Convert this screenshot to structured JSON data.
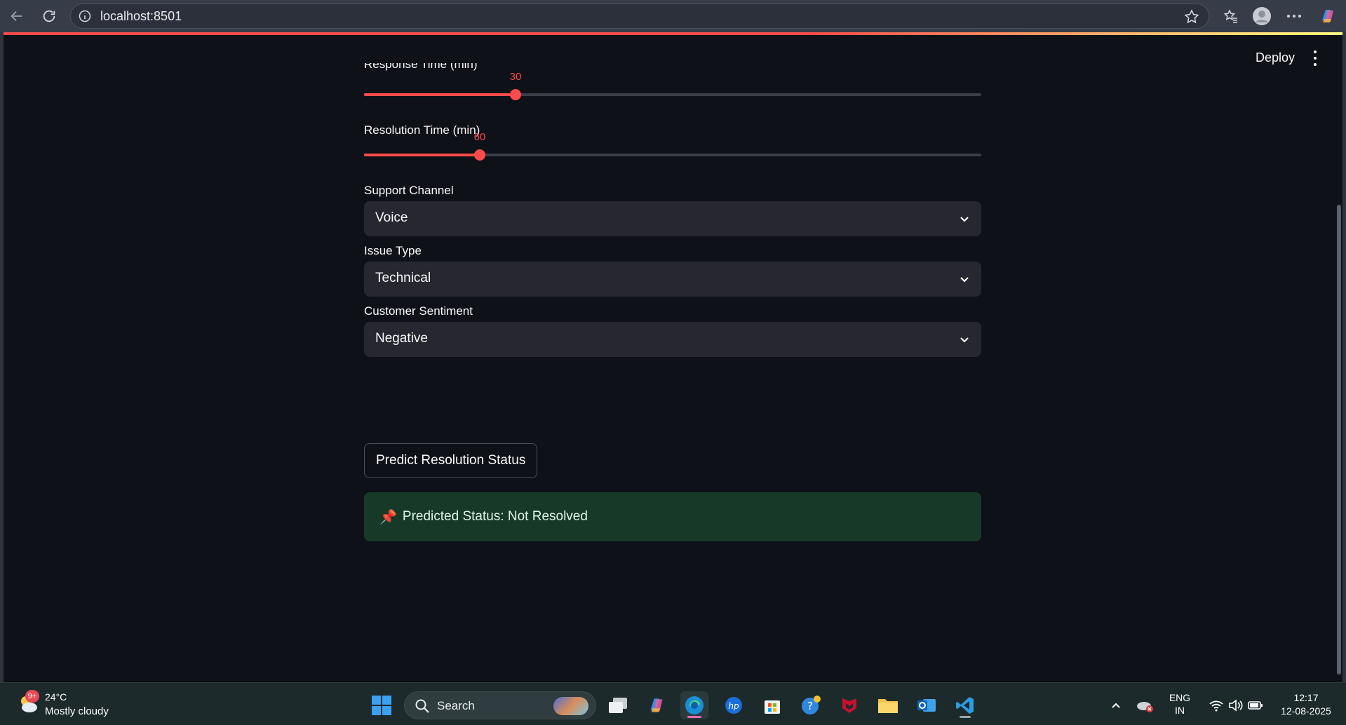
{
  "browser": {
    "url": "localhost:8501"
  },
  "app": {
    "deploy_label": "Deploy",
    "response_time": {
      "label": "Response Time (min)",
      "value": "30",
      "fraction": 0.245
    },
    "resolution_time": {
      "label": "Resolution Time (min)",
      "value": "60",
      "fraction": 0.188
    },
    "support_channel": {
      "label": "Support Channel",
      "selected": "Voice"
    },
    "issue_type": {
      "label": "Issue Type",
      "selected": "Technical"
    },
    "customer_sentiment": {
      "label": "Customer Sentiment",
      "selected": "Negative"
    },
    "predict_button": "Predict Resolution Status",
    "result": {
      "icon": "pushpin-icon",
      "text": "Predicted Status: Not Resolved"
    },
    "colors": {
      "accent": "#ff4b4b",
      "success_bg": "#173928",
      "background": "#0e1117"
    }
  },
  "taskbar": {
    "weather": {
      "badge": "9+",
      "temp": "24°C",
      "desc": "Mostly cloudy"
    },
    "search_label": "Search",
    "language": {
      "line1": "ENG",
      "line2": "IN"
    },
    "clock": {
      "time": "12:17",
      "date": "12-08-2025"
    }
  }
}
